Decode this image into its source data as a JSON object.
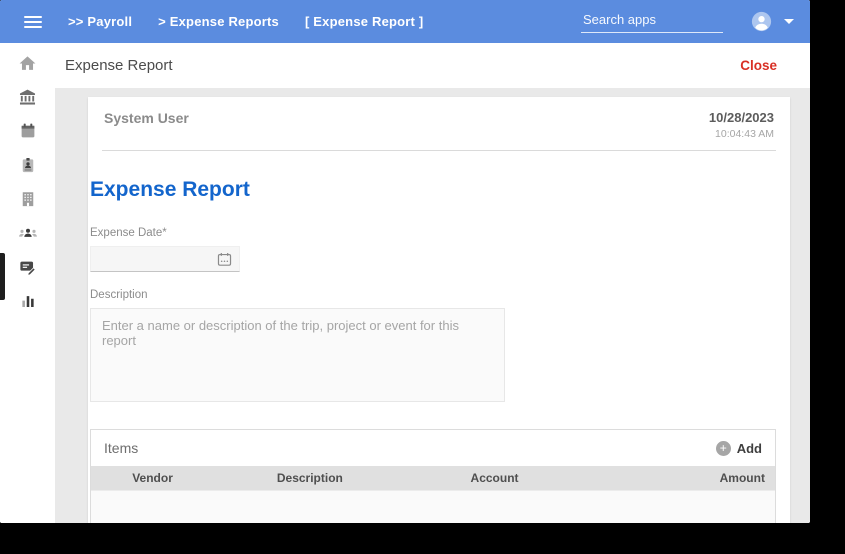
{
  "topbar": {
    "breadcrumbs": [
      ">> Payroll",
      "> Expense Reports",
      "[ Expense Report ]"
    ],
    "search_placeholder": "Search apps"
  },
  "header": {
    "title": "Expense Report",
    "close_label": "Close"
  },
  "sidebar": {
    "icons": [
      "home-icon",
      "bank-icon",
      "calendar-icon",
      "badge-icon",
      "building-icon",
      "people-icon",
      "edit-note-icon",
      "bar-chart-icon"
    ],
    "active_item": "edit-note"
  },
  "card": {
    "user": "System User",
    "date": "10/28/2023",
    "time": "10:04:43 AM",
    "form_title": "Expense Report",
    "expense_date_label": "Expense Date*",
    "expense_date_value": "",
    "description_label": "Description",
    "description_placeholder": "Enter a name or description of the trip, project or event for this report",
    "items": {
      "title": "Items",
      "add_label": "Add",
      "columns": [
        "Vendor",
        "Description",
        "Account",
        "Amount"
      ],
      "rows": []
    }
  },
  "colors": {
    "topbar_blue": "#5b8cdf",
    "form_title_blue": "#1365cc",
    "close_red": "#d93025",
    "content_bg": "#e9e9e9",
    "table_header_bg": "#e0e0e0"
  }
}
